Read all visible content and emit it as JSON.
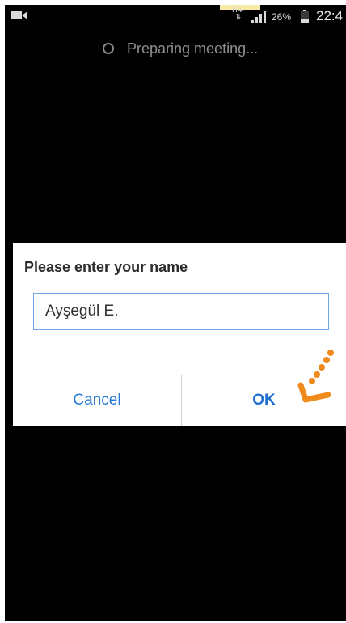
{
  "status_bar": {
    "network_type": "H+",
    "network_arrows": "⇅",
    "battery_percent": "26%",
    "time": "22:4",
    "icons": [
      "video-camera-icon",
      "signal-icon",
      "battery-icon"
    ]
  },
  "meeting": {
    "status_text": "Preparing meeting..."
  },
  "dialog": {
    "title": "Please enter your name",
    "name_value": "Ayşegül E.",
    "cancel_label": "Cancel",
    "ok_label": "OK"
  },
  "colors": {
    "background": "#000000",
    "dialog_bg": "#ffffff",
    "accent_blue": "#2a7ad6",
    "field_border": "#6ea7e8",
    "tap_indicator": "#f08a1c"
  }
}
